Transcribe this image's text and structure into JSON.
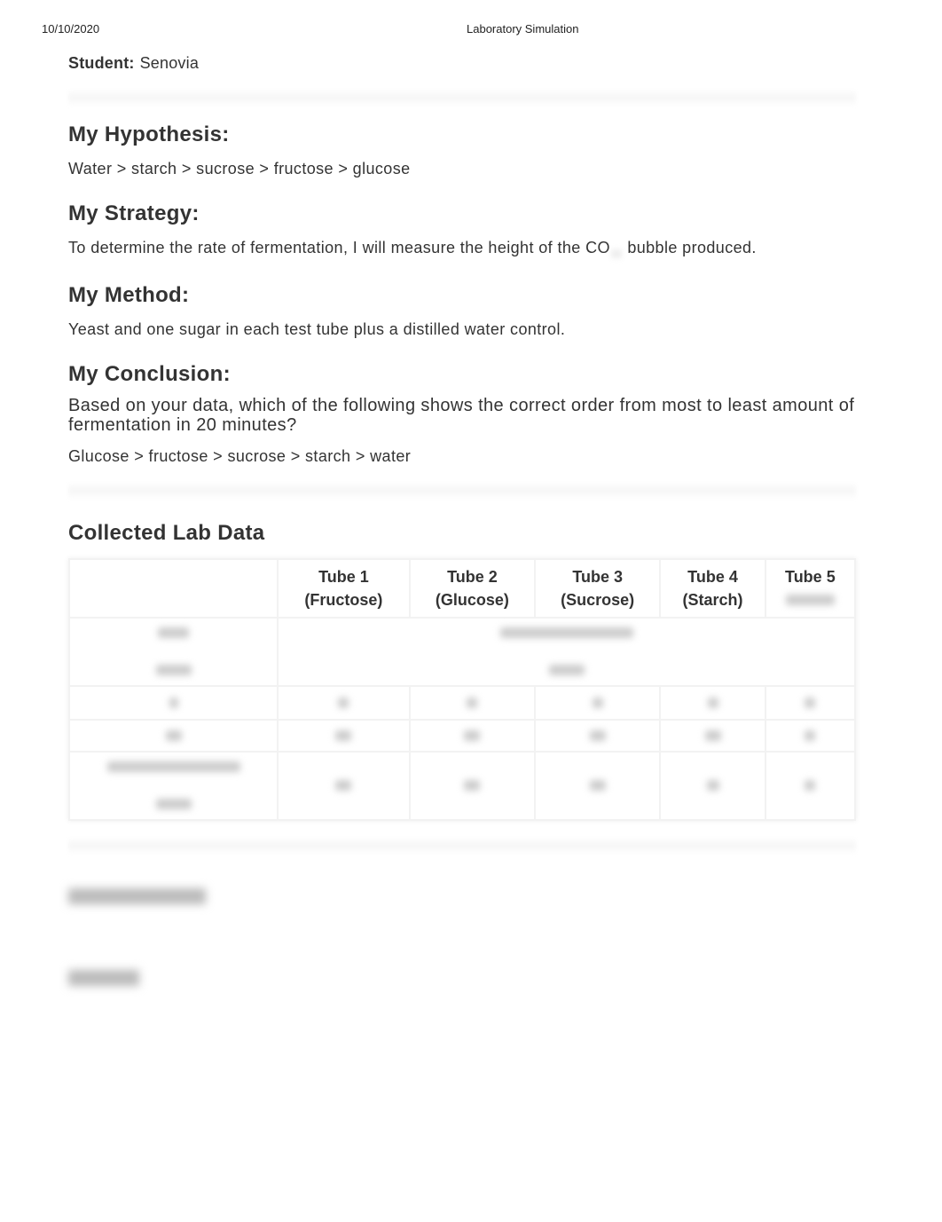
{
  "header": {
    "date": "10/10/2020",
    "title": "Laboratory Simulation"
  },
  "student": {
    "label": "Student:",
    "name": "Senovia"
  },
  "hypothesis": {
    "heading": "My Hypothesis:",
    "text": "Water > starch > sucrose > fructose > glucose"
  },
  "strategy": {
    "heading": "My Strategy:",
    "text_before": "To determine the rate of fermentation, I will measure the height of the CO",
    "text_after": "bubble produced."
  },
  "method": {
    "heading": "My Method:",
    "text": "Yeast and one sugar in each test tube plus a distilled water control."
  },
  "conclusion": {
    "heading": "My Conclusion:",
    "question": "Based on your data, which of the following shows the correct order from most to least amount of fermentation in 20 minutes?",
    "answer": "Glucose > fructose > sucrose > starch > water"
  },
  "lab_data": {
    "heading": "Collected Lab Data",
    "columns": [
      {
        "tube": "Tube 1",
        "sugar": "(Fructose)"
      },
      {
        "tube": "Tube 2",
        "sugar": "(Glucose)"
      },
      {
        "tube": "Tube 3",
        "sugar": "(Sucrose)"
      },
      {
        "tube": "Tube 4",
        "sugar": "(Starch)"
      },
      {
        "tube": "Tube 5",
        "sugar": ""
      }
    ]
  }
}
